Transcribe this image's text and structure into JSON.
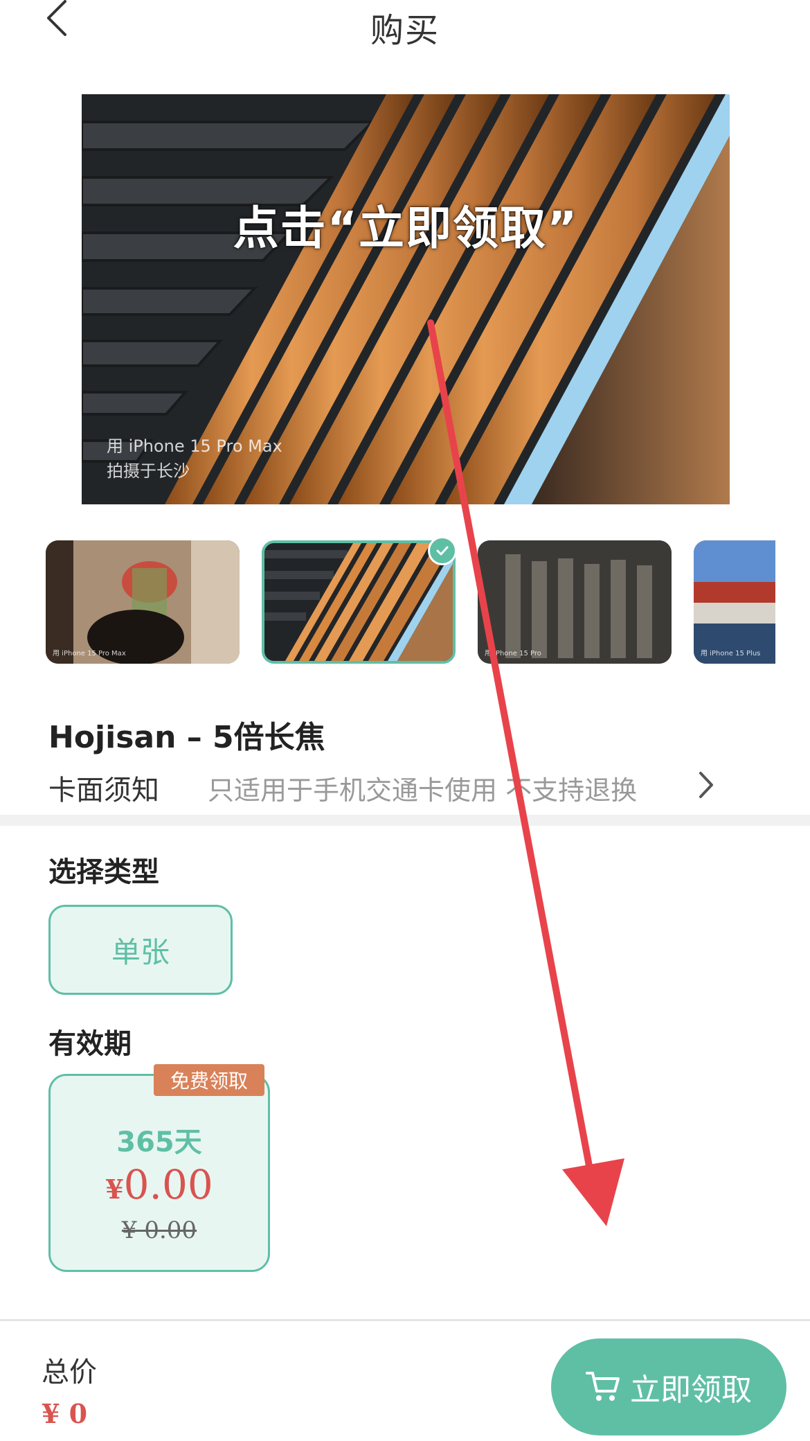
{
  "header": {
    "title": "购买",
    "back_icon": "chevron-left-icon"
  },
  "hero": {
    "overlay_title": "点击“立即领取”",
    "caption_line1": "用 iPhone 15 Pro Max",
    "caption_line2": "拍摄于长沙"
  },
  "thumbnails": [
    {
      "caption": "用 iPhone 15 Pro Max",
      "selected": false
    },
    {
      "caption": "",
      "selected": true
    },
    {
      "caption": "用 iPhone 15 Pro",
      "selected": false
    },
    {
      "caption": "用 iPhone 15 Plus",
      "selected": false
    }
  ],
  "product": {
    "name": "Hojisan – 5倍长焦",
    "notice_label": "卡面须知",
    "notice_text": "只适用于手机交通卡使用 不支持退换"
  },
  "type_section": {
    "title": "选择类型",
    "option": "单张"
  },
  "validity_section": {
    "title": "有效期",
    "tag": "免费领取",
    "days": "365天",
    "price_symbol": "¥",
    "price": "0.00",
    "original_price": "¥ 0.00"
  },
  "bottom_bar": {
    "total_label": "总价",
    "total_price": "¥ 0",
    "claim_button": "立即领取",
    "cart_icon": "cart-icon"
  },
  "colors": {
    "accent": "#5fbfa5",
    "accent_bg": "#e8f6f2",
    "price_red": "#d9534f",
    "tag_orange": "#d9825a",
    "annotation_arrow": "#e8434b"
  }
}
